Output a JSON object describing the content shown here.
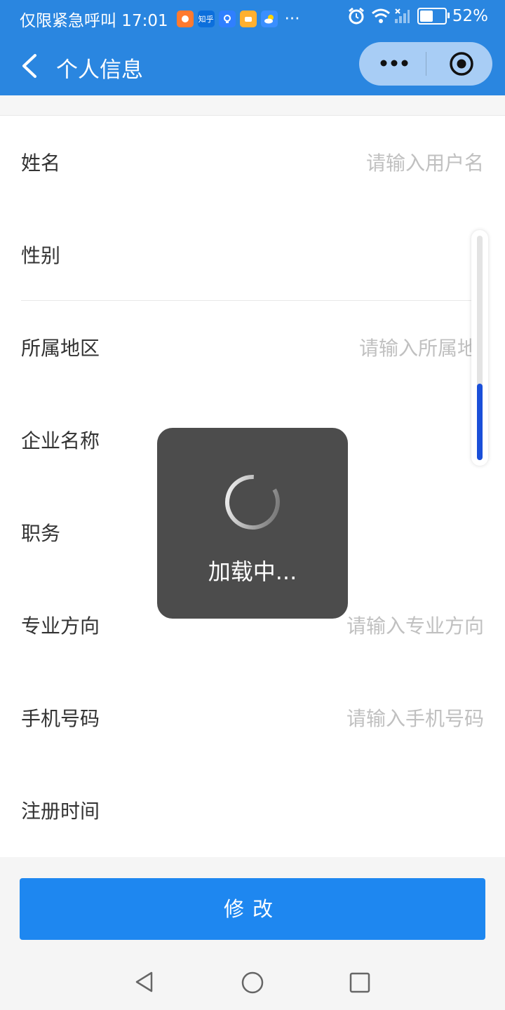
{
  "status_bar": {
    "left_text": "仅限紧急呼叫 17:01",
    "app_icons": [
      {
        "name": "app-icon-1",
        "color": "#ff7a2f",
        "label": ""
      },
      {
        "name": "zhihu-icon",
        "color": "#0c6fdc",
        "label": "知乎"
      },
      {
        "name": "bulb-icon",
        "color": "#2f7fff",
        "label": ""
      },
      {
        "name": "app-icon-2",
        "color": "#ffb030",
        "label": ""
      },
      {
        "name": "weather-icon",
        "color": "#3a8fff",
        "label": ""
      }
    ],
    "more": "···",
    "battery_text": "52%",
    "battery_level": 0.52
  },
  "nav": {
    "title": "个人信息"
  },
  "form": {
    "rows": [
      {
        "label": "姓名",
        "placeholder": "请输入用户名"
      },
      {
        "label": "性别",
        "placeholder": ""
      },
      {
        "label": "所属地区",
        "placeholder": "请输入所属地区"
      },
      {
        "label": "企业名称",
        "placeholder": ""
      },
      {
        "label": "职务",
        "placeholder": ""
      },
      {
        "label": "专业方向",
        "placeholder": "请输入专业方向"
      },
      {
        "label": "手机号码",
        "placeholder": "请输入手机号码"
      },
      {
        "label": "注册时间",
        "placeholder": ""
      }
    ]
  },
  "scroll": {
    "position_fraction": 0.66,
    "thumb_fraction": 0.34
  },
  "toast": {
    "text": "加载中..."
  },
  "button": {
    "label": "修改"
  },
  "colors": {
    "primary": "#1e87f0",
    "header": "#2a86e0",
    "scroll_thumb": "#1a4fd9"
  }
}
